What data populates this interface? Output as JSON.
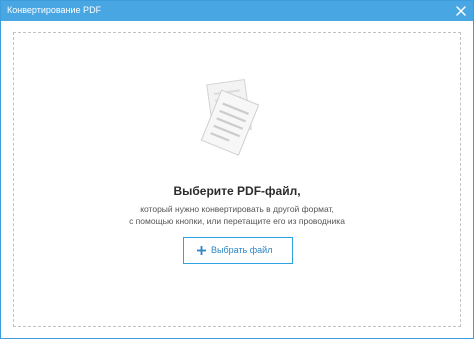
{
  "window": {
    "title": "Конвертирование PDF",
    "close_icon": "close-icon"
  },
  "drop_zone": {
    "icon": "documents-icon",
    "heading": "Выберите PDF-файл,",
    "subtitle_line_1": "который нужно конвертировать в другой формат,",
    "subtitle_line_2": "с помощью кнопки, или перетащите его из проводника",
    "button": {
      "icon": "plus-icon",
      "label": "Выбрать файл"
    }
  },
  "colors": {
    "titlebar": "#48a6e3",
    "accent": "#2fa3e0",
    "dashed_border": "#c2c2c2"
  }
}
